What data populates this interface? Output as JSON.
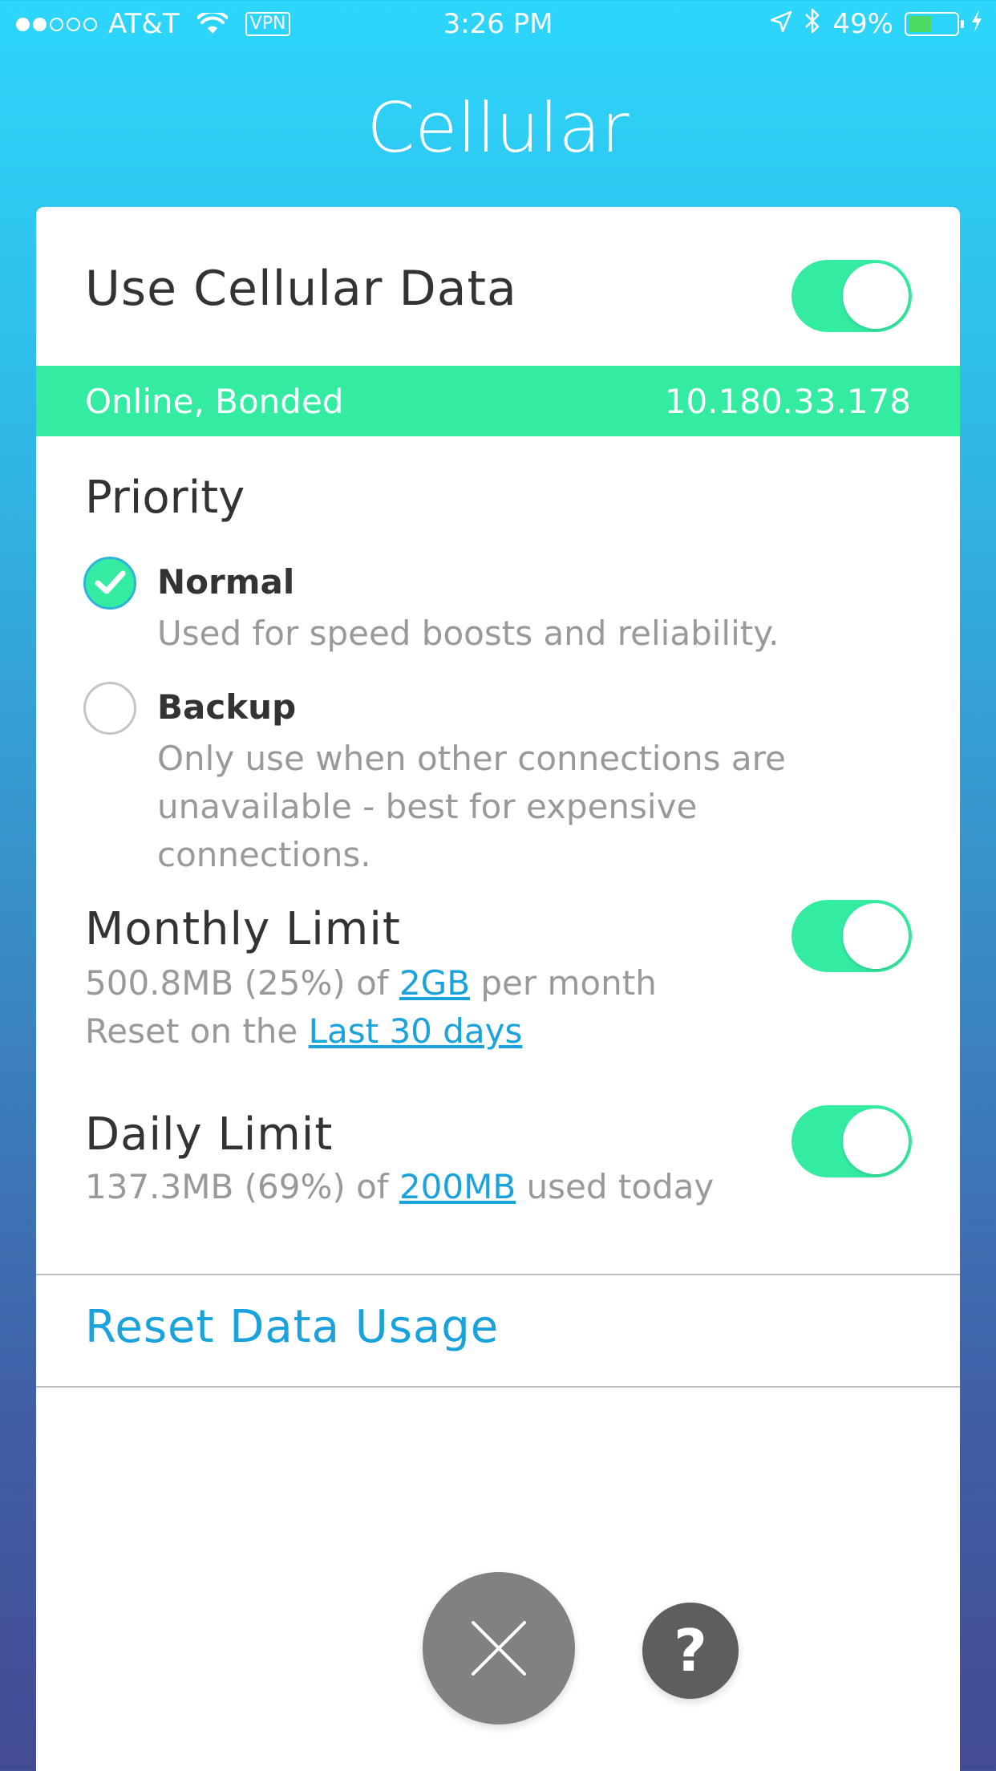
{
  "status_bar": {
    "carrier": "AT&T",
    "vpn": "VPN",
    "time": "3:26 PM",
    "battery": "49%",
    "battery_level": 0.49,
    "signal_bars_filled": 2,
    "signal_bars_total": 5
  },
  "page": {
    "title": "Cellular"
  },
  "use_cellular": {
    "label": "Use Cellular Data",
    "enabled": true
  },
  "connection": {
    "status": "Online, Bonded",
    "ip": "10.180.33.178"
  },
  "priority": {
    "heading": "Priority",
    "options": [
      {
        "title": "Normal",
        "description": "Used for speed boosts and reliability.",
        "selected": true
      },
      {
        "title": "Backup",
        "description": "Only use when other connections are unavailable - best for expensive connections.",
        "selected": false
      }
    ]
  },
  "monthly_limit": {
    "heading": "Monthly Limit",
    "enabled": true,
    "usage_prefix": "500.8MB (25%) of ",
    "limit": "2GB",
    "usage_suffix": " per month",
    "reset_prefix": "Reset on the ",
    "reset_period": "Last 30 days"
  },
  "daily_limit": {
    "heading": "Daily Limit",
    "enabled": true,
    "usage_prefix": "137.3MB (69%) of ",
    "limit": "200MB",
    "usage_suffix": " used today"
  },
  "reset_action": {
    "label": "Reset Data Usage"
  },
  "help_button": {
    "label": "?"
  },
  "colors": {
    "accent_green": "#33eca2",
    "link_blue": "#1aa2dc",
    "background_top": "#2dd6fb",
    "background_bottom": "#434b94"
  }
}
